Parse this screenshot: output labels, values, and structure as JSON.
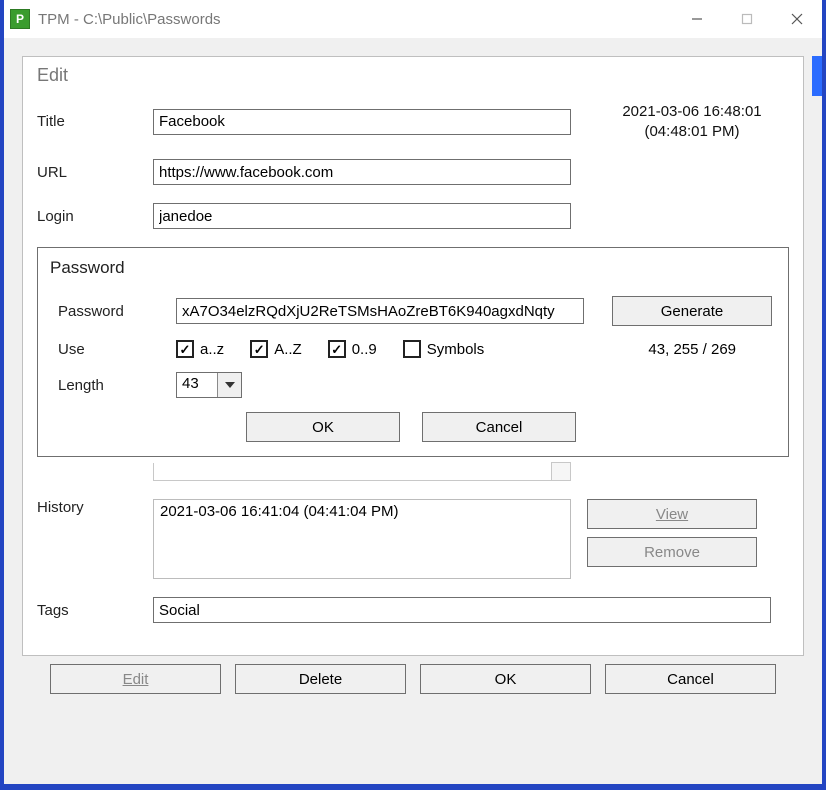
{
  "window": {
    "title": "TPM - C:\\Public\\Passwords",
    "app_icon_letter": "P"
  },
  "panel": {
    "heading": "Edit",
    "timestamp_line1": "2021-03-06 16:48:01",
    "timestamp_line2": "(04:48:01 PM)"
  },
  "labels": {
    "title": "Title",
    "url": "URL",
    "login": "Login",
    "password_group": "Password",
    "password": "Password",
    "use": "Use",
    "length": "Length",
    "history": "History",
    "tags": "Tags"
  },
  "fields": {
    "title": "Facebook",
    "url": "https://www.facebook.com",
    "login": "janedoe",
    "password": "xA7O34elzRQdXjU2ReTSMsHAoZreBT6K940agxdNqty",
    "length": "43",
    "tags": "Social"
  },
  "checks": {
    "az": "a..z",
    "AZ": "A..Z",
    "digits": "0..9",
    "symbols": "Symbols"
  },
  "stats": "43, 255 / 269",
  "buttons": {
    "generate": "Generate",
    "ok": "OK",
    "cancel": "Cancel",
    "view": "View",
    "remove": "Remove",
    "edit": "Edit",
    "delete": "Delete"
  },
  "history": {
    "entry": "2021-03-06 16:41:04 (04:41:04 PM)"
  }
}
